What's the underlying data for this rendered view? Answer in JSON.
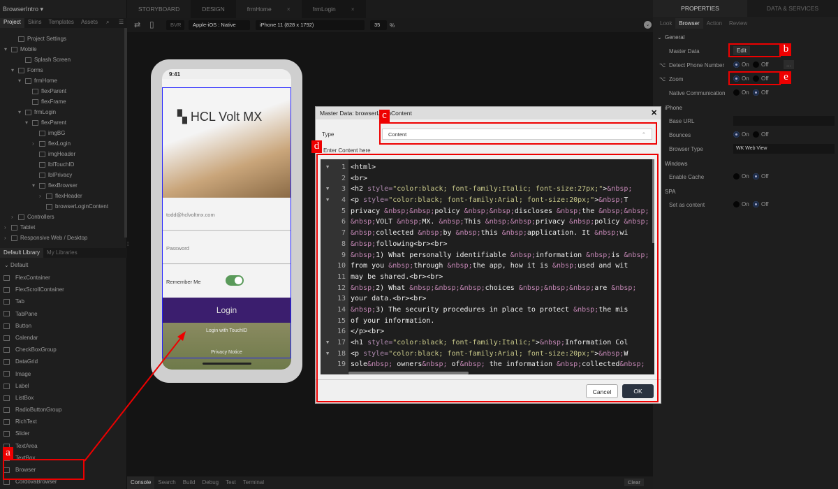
{
  "app_title": "BrowserIntro",
  "project_tabs": [
    "Project",
    "Skins",
    "Templates",
    "Assets"
  ],
  "tree": [
    {
      "label": "Project Settings",
      "level": 1,
      "arrow": ""
    },
    {
      "label": "Mobile",
      "level": 0,
      "arrow": "▾"
    },
    {
      "label": "Splash Screen",
      "level": 2,
      "arrow": ""
    },
    {
      "label": "Forms",
      "level": 1,
      "arrow": "▾"
    },
    {
      "label": "frmHome",
      "level": 2,
      "arrow": "▾"
    },
    {
      "label": "flexParent",
      "level": 3,
      "arrow": ""
    },
    {
      "label": "flexFrame",
      "level": 3,
      "arrow": ""
    },
    {
      "label": "frmLogin",
      "level": 2,
      "arrow": "▾"
    },
    {
      "label": "flexParent",
      "level": 3,
      "arrow": "▾"
    },
    {
      "label": "imgBG",
      "level": 4,
      "arrow": ""
    },
    {
      "label": "flexLogin",
      "level": 4,
      "arrow": "›"
    },
    {
      "label": "imgHeader",
      "level": 4,
      "arrow": ""
    },
    {
      "label": "lblTouchID",
      "level": 4,
      "arrow": ""
    },
    {
      "label": "lblPrivacy",
      "level": 4,
      "arrow": ""
    },
    {
      "label": "flexBrowser",
      "level": 4,
      "arrow": "▾"
    },
    {
      "label": "flexHeader",
      "level": 5,
      "arrow": "›"
    },
    {
      "label": "browserLoginContent",
      "level": 5,
      "arrow": ""
    },
    {
      "label": "Controllers",
      "level": 1,
      "arrow": "›"
    },
    {
      "label": "Tablet",
      "level": 0,
      "arrow": "›"
    },
    {
      "label": "Responsive Web / Desktop",
      "level": 0,
      "arrow": "›"
    }
  ],
  "library_tabs": [
    "Default Library",
    "My Libraries"
  ],
  "library_group": "Default",
  "library_items": [
    "FlexContainer",
    "FlexScrollContainer",
    "Tab",
    "TabPane",
    "Button",
    "Calendar",
    "CheckBoxGroup",
    "DataGrid",
    "Image",
    "Label",
    "ListBox",
    "RadioButtonGroup",
    "RichText",
    "Slider",
    "TextArea",
    "TextBox",
    "Browser",
    "CordovaBrowser"
  ],
  "top_tabs": [
    "STORYBOARD",
    "DESIGN",
    "frmHome",
    "frmLogin"
  ],
  "toolbar": {
    "bvr": "BVR",
    "platform": "Apple-iOS : Native",
    "device": "iPhone 11 (828 x 1792)",
    "zoom": "35",
    "zoom_unit": "%"
  },
  "phone": {
    "time": "9:41",
    "brand": "HCL Volt MX",
    "email_placeholder": "todd@hclvoltmx.com",
    "password_placeholder": "Password",
    "remember": "Remember Me",
    "login": "Login",
    "touchid": "Login with TouchID",
    "privacy": "Privacy Notice"
  },
  "console_tabs": [
    "Console",
    "Search",
    "Build",
    "Debug",
    "Test",
    "Terminal"
  ],
  "console_clear": "Clear",
  "right_tabs": [
    "PROPERTIES",
    "DATA & SERVICES"
  ],
  "prop_tabs": [
    "Look",
    "Browser",
    "Action",
    "Review"
  ],
  "props": {
    "general": "General",
    "master_data": "Master Data",
    "edit": "Edit",
    "detect_phone": "Detect Phone Number",
    "zoom": "Zoom",
    "native_comm": "Native Communication",
    "iphone": "iPhone",
    "base_url": "Base URL",
    "bounces": "Bounces",
    "browser_type": "Browser Type",
    "browser_type_value": "WK Web View",
    "windows": "Windows",
    "enable_cache": "Enable Cache",
    "spa": "SPA",
    "set_as_content": "Set as content",
    "on": "On",
    "off": "Off",
    "more": "..."
  },
  "dialog": {
    "title": "Master Data: browserLoginContent",
    "type_label": "Type",
    "type_value": "Content",
    "content_label": "Enter Content here",
    "cancel": "Cancel",
    "ok": "OK",
    "code_lines": [
      "<html>",
      "<br>",
      "<h2 style=\"color:black; font-family:Italic; font-size:27px;\">&nbsp;",
      "<p style=\"color:black; font-family:Arial; font-size:20px;\">&nbsp;T",
      "privacy &nbsp;&nbsp;policy &nbsp;&nbsp;discloses &nbsp;the &nbsp;&nbsp;",
      "&nbsp;VOLT &nbsp;MX. &nbsp;This &nbsp;&nbsp;privacy &nbsp;policy &nbsp;",
      "&nbsp;collected &nbsp;by &nbsp;this &nbsp;application. It &nbsp;wi",
      "&nbsp;following<br><br>",
      "&nbsp;1) What personally identifiable &nbsp;information &nbsp;is &nbsp;",
      "from you &nbsp;through &nbsp;the app, how it is &nbsp;used and wit",
      "may be shared.<br><br>",
      "&nbsp;2) What &nbsp;&nbsp;&nbsp;choices &nbsp;&nbsp;&nbsp;are &nbsp;",
      "your data.<br><br>",
      "&nbsp;3) The security procedures in place to protect &nbsp;the mis",
      "of your information.",
      "</p><br>",
      "<h1 style=\"color:black; font-family:Italic;\">&nbsp;Information Col",
      "<p style=\"color:black; font-family:Arial; font-size:20px;\">&nbsp;W",
      "sole&nbsp; owners&nbsp; of&nbsp; the information &nbsp;collected&nbsp;"
    ],
    "folds": [
      1,
      3,
      4,
      17,
      18
    ]
  },
  "annotations": [
    "a",
    "b",
    "c",
    "d",
    "e"
  ]
}
